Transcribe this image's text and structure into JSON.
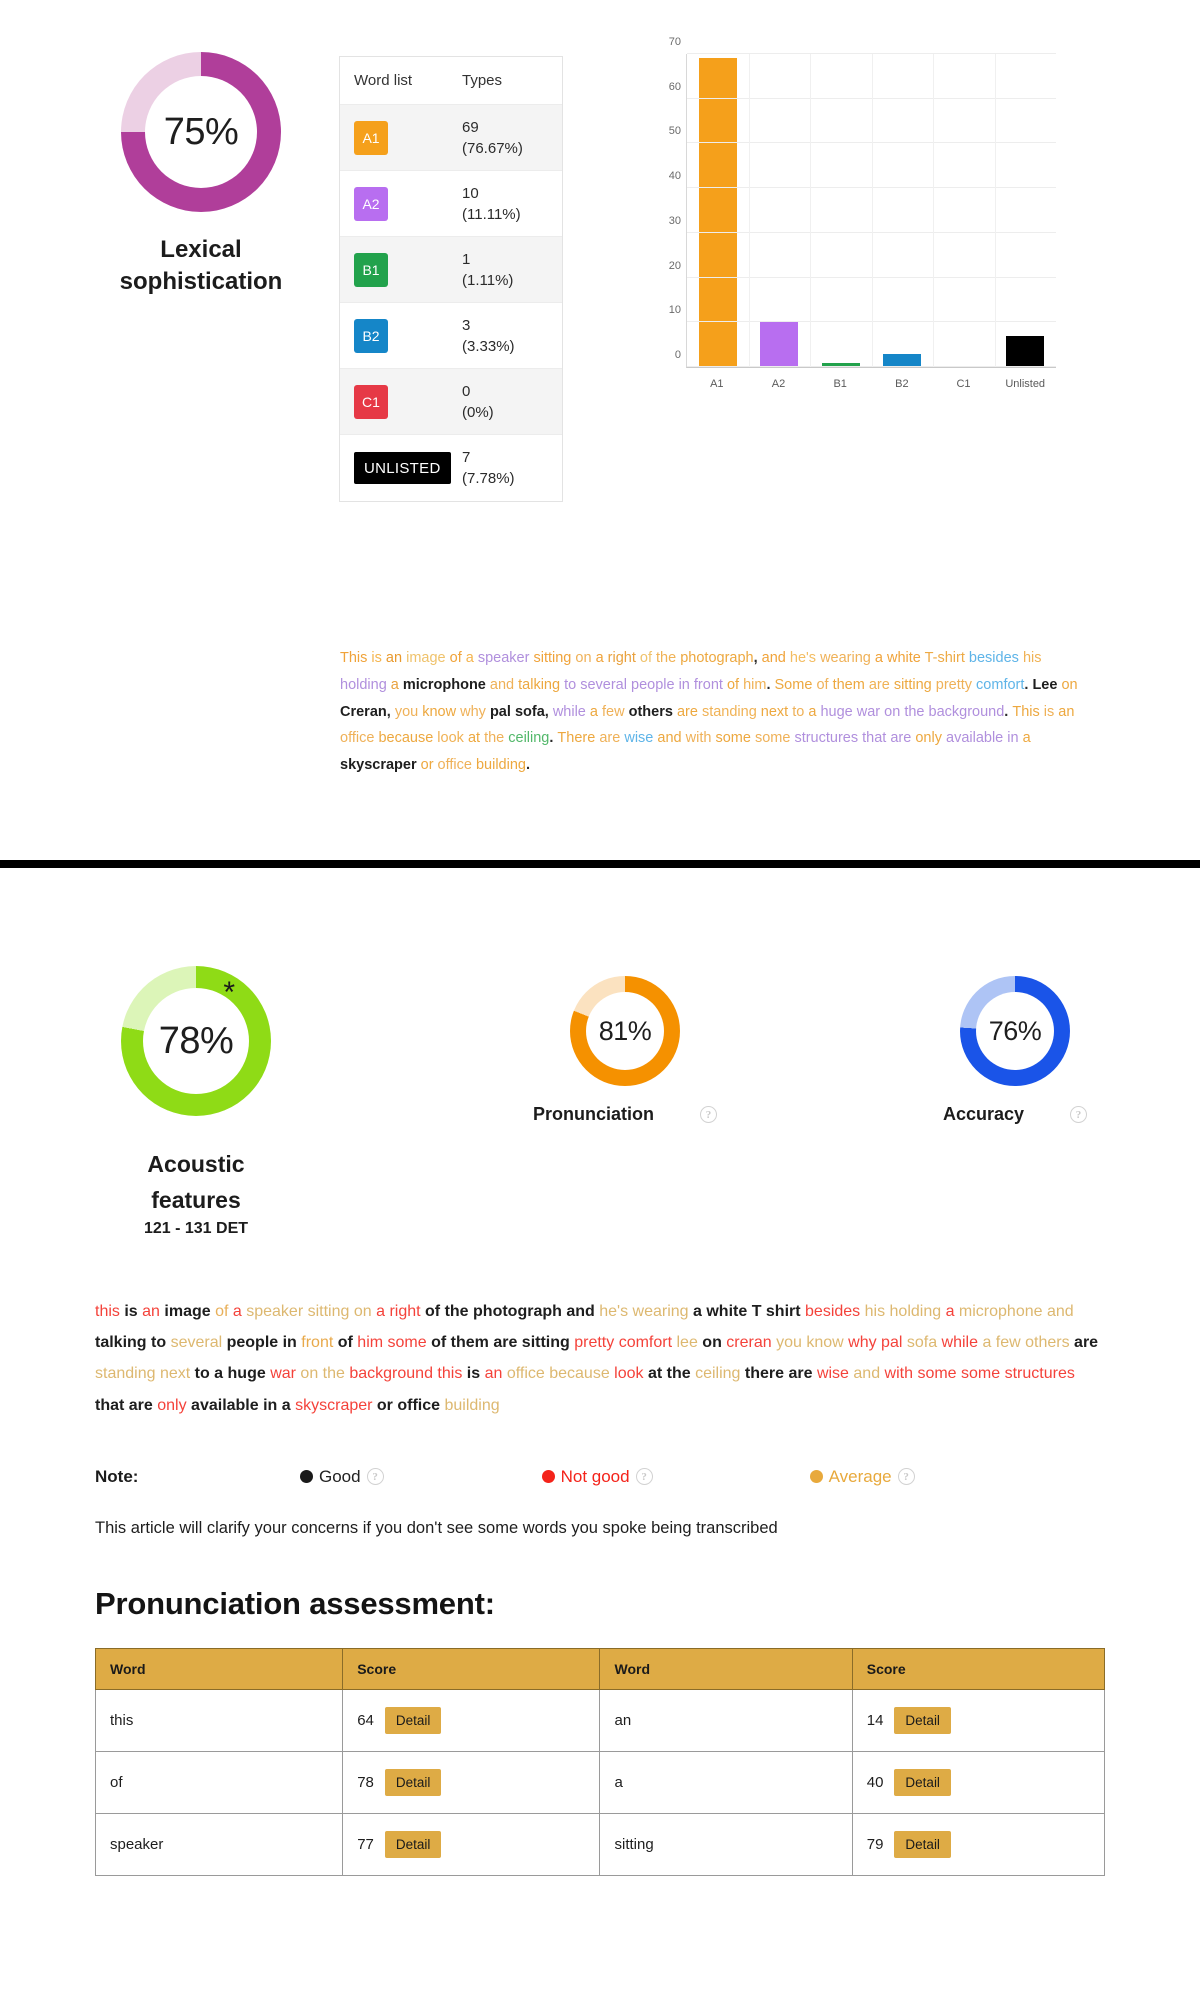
{
  "lexical": {
    "percent_label": "75%",
    "percent_value": 75,
    "caption_line1": "Lexical",
    "caption_line2": "sophistication",
    "track_color": "#ecd0e4",
    "fill_color": "#b03e9a"
  },
  "word_list_table": {
    "headers": [
      "Word list",
      "Types"
    ],
    "rows": [
      {
        "level": "A1",
        "color": "#f5a01b",
        "types": "69",
        "percent": "(76.67%)"
      },
      {
        "level": "A2",
        "color": "#b86ef0",
        "types": "10",
        "percent": "(11.11%)"
      },
      {
        "level": "B1",
        "color": "#22a24c",
        "types": "1",
        "percent": "(1.11%)"
      },
      {
        "level": "B2",
        "color": "#1586c8",
        "types": "3",
        "percent": "(3.33%)"
      },
      {
        "level": "C1",
        "color": "#e63murky",
        "types": "0",
        "percent": "(0%)"
      },
      {
        "level": "UNLISTED",
        "color": "#000000",
        "types": "7",
        "percent": "(7.78%)"
      }
    ]
  },
  "chart_data": {
    "type": "bar",
    "title": "",
    "xlabel": "",
    "ylabel": "",
    "categories": [
      "A1",
      "A2",
      "B1",
      "B2",
      "C1",
      "Unlisted"
    ],
    "values": [
      69,
      10,
      1,
      3,
      0,
      7
    ],
    "colors": [
      "#f5a01b",
      "#b86ef0",
      "#22a24c",
      "#1586c8",
      "#e63946",
      "#000000"
    ],
    "ylim": [
      0,
      70
    ],
    "yticks": [
      0,
      10,
      20,
      30,
      40,
      50,
      60,
      70
    ],
    "ytick_labels": [
      "0",
      "10",
      "20",
      "30",
      "40",
      "50",
      "60",
      "70"
    ],
    "grid": true,
    "legend": "none"
  },
  "paragraph_one": {
    "tokens": [
      {
        "t": "This ",
        "c": "#f0a33a"
      },
      {
        "t": "is ",
        "c": "#f5b54f"
      },
      {
        "t": "an ",
        "c": "#e99a2e"
      },
      {
        "t": "image ",
        "c": "#efc26b"
      },
      {
        "t": "of ",
        "c": "#f0a33a"
      },
      {
        "t": "a ",
        "c": "#f5b54f"
      },
      {
        "t": "speaker ",
        "c": "#b08fdd"
      },
      {
        "t": "sitting ",
        "c": "#f0a33a"
      },
      {
        "t": "on ",
        "c": "#efb158"
      },
      {
        "t": "a ",
        "c": "#f0a33a"
      },
      {
        "t": "right ",
        "c": "#e9a13d"
      },
      {
        "t": "of ",
        "c": "#efc26b"
      },
      {
        "t": "the ",
        "c": "#f0b255"
      },
      {
        "t": "photograph",
        "c": "#eda83f"
      },
      {
        "t": ", ",
        "c": "#2b2b2b"
      },
      {
        "t": "and ",
        "c": "#f0a33a"
      },
      {
        "t": "he's ",
        "c": "#f3bd62"
      },
      {
        "t": "wearing ",
        "c": "#efb158"
      },
      {
        "t": "a ",
        "c": "#f0a33a"
      },
      {
        "t": "white ",
        "c": "#f0a33a"
      },
      {
        "t": "T-shirt ",
        "c": "#edaa45"
      },
      {
        "t": "besides ",
        "c": "#5eb4e8"
      },
      {
        "t": "his ",
        "c": "#f0b255"
      },
      {
        "t": "holding ",
        "c": "#b08fdd"
      },
      {
        "t": "a ",
        "c": "#e9a13d"
      },
      {
        "t": "microphone ",
        "c": "#1e1e1e"
      },
      {
        "t": "and ",
        "c": "#efb158"
      },
      {
        "t": "talking ",
        "c": "#eda83f"
      },
      {
        "t": "to ",
        "c": "#b08fdd"
      },
      {
        "t": "several ",
        "c": "#b08fdd"
      },
      {
        "t": "people ",
        "c": "#b08fdd"
      },
      {
        "t": "in ",
        "c": "#b08fdd"
      },
      {
        "t": "front ",
        "c": "#b08fdd"
      },
      {
        "t": "of ",
        "c": "#eda83f"
      },
      {
        "t": "him",
        "c": "#f0b255"
      },
      {
        "t": ". ",
        "c": "#2b2b2b"
      },
      {
        "t": "Some ",
        "c": "#eda83f"
      },
      {
        "t": "of ",
        "c": "#efb158"
      },
      {
        "t": "them ",
        "c": "#eda83f"
      },
      {
        "t": "are ",
        "c": "#f0b255"
      },
      {
        "t": "sitting ",
        "c": "#eda83f"
      },
      {
        "t": "pretty ",
        "c": "#efb158"
      },
      {
        "t": "comfort",
        "c": "#5eb4e8"
      },
      {
        "t": ". ",
        "c": "#2b2b2b"
      },
      {
        "t": "Lee ",
        "c": "#1e1e1e"
      },
      {
        "t": "on ",
        "c": "#eda83f"
      },
      {
        "t": "Creran",
        "c": "#1e1e1e"
      },
      {
        "t": ", ",
        "c": "#2b2b2b"
      },
      {
        "t": "you ",
        "c": "#efb158"
      },
      {
        "t": "know ",
        "c": "#eda83f"
      },
      {
        "t": "why ",
        "c": "#efb158"
      },
      {
        "t": "pal ",
        "c": "#1e1e1e"
      },
      {
        "t": "sofa",
        "c": "#1e1e1e"
      },
      {
        "t": ", ",
        "c": "#2b2b2b"
      },
      {
        "t": "while ",
        "c": "#b08fdd"
      },
      {
        "t": "a ",
        "c": "#eda83f"
      },
      {
        "t": "few ",
        "c": "#efb158"
      },
      {
        "t": "others ",
        "c": "#1e1e1e"
      },
      {
        "t": "are ",
        "c": "#eda83f"
      },
      {
        "t": "standing ",
        "c": "#f0b255"
      },
      {
        "t": "next ",
        "c": "#eda83f"
      },
      {
        "t": "to ",
        "c": "#efb158"
      },
      {
        "t": "a ",
        "c": "#eda83f"
      },
      {
        "t": "huge ",
        "c": "#b08fdd"
      },
      {
        "t": "war ",
        "c": "#b08fdd"
      },
      {
        "t": "on ",
        "c": "#b08fdd"
      },
      {
        "t": "the ",
        "c": "#b08fdd"
      },
      {
        "t": "background",
        "c": "#b08fdd"
      },
      {
        "t": ". ",
        "c": "#2b2b2b"
      },
      {
        "t": "This ",
        "c": "#eda83f"
      },
      {
        "t": "is ",
        "c": "#efb158"
      },
      {
        "t": "an ",
        "c": "#eda83f"
      },
      {
        "t": "office ",
        "c": "#efb158"
      },
      {
        "t": "because ",
        "c": "#eda83f"
      },
      {
        "t": "look ",
        "c": "#f0b255"
      },
      {
        "t": "at ",
        "c": "#eda83f"
      },
      {
        "t": "the ",
        "c": "#efb158"
      },
      {
        "t": "ceiling",
        "c": "#52b86a"
      },
      {
        "t": ". ",
        "c": "#2b2b2b"
      },
      {
        "t": "There ",
        "c": "#eda83f"
      },
      {
        "t": "are ",
        "c": "#efb158"
      },
      {
        "t": "wise ",
        "c": "#5eb4e8"
      },
      {
        "t": "and ",
        "c": "#eda83f"
      },
      {
        "t": "with ",
        "c": "#efb158"
      },
      {
        "t": "some ",
        "c": "#eda83f"
      },
      {
        "t": "some ",
        "c": "#efb158"
      },
      {
        "t": "structures ",
        "c": "#b08fdd"
      },
      {
        "t": "that ",
        "c": "#b08fdd"
      },
      {
        "t": "are ",
        "c": "#b08fdd"
      },
      {
        "t": "only ",
        "c": "#eda83f"
      },
      {
        "t": "available ",
        "c": "#b08fdd"
      },
      {
        "t": "in ",
        "c": "#b08fdd"
      },
      {
        "t": "a ",
        "c": "#eda83f"
      },
      {
        "t": "skyscraper ",
        "c": "#1e1e1e"
      },
      {
        "t": "or ",
        "c": "#eda83f"
      },
      {
        "t": "office ",
        "c": "#efb158"
      },
      {
        "t": "building",
        "c": "#eda83f"
      },
      {
        "t": ".",
        "c": "#2b2b2b"
      }
    ]
  },
  "acoustic": {
    "percent_label": "78%",
    "percent_value": 78,
    "star": "*",
    "caption_line1": "Acoustic",
    "caption_line2": "features",
    "sub_caption": "121 - 131 DET",
    "track_color": "#dcf5b8",
    "fill_color": "#8fdb16"
  },
  "pronunciation": {
    "percent_label": "81%",
    "percent_value": 81,
    "caption": "Pronunciation",
    "help_icon": "question-mark-icon",
    "track_color": "#fbe2c0",
    "fill_color": "#f59100"
  },
  "accuracy": {
    "percent_label": "76%",
    "percent_value": 76,
    "caption": "Accuracy",
    "help_icon": "question-mark-icon",
    "track_color": "#aec4f5",
    "fill_color": "#1a54e8"
  },
  "paragraph_two": {
    "tokens": [
      {
        "t": "this ",
        "c": "#f4423a"
      },
      {
        "t": "is ",
        "c": "#1e1e1e"
      },
      {
        "t": "an ",
        "c": "#f4423a"
      },
      {
        "t": "image ",
        "c": "#1e1e1e"
      },
      {
        "t": "of ",
        "c": "#e8b05a"
      },
      {
        "t": "a ",
        "c": "#f4423a"
      },
      {
        "t": "speaker ",
        "c": "#ddb870"
      },
      {
        "t": "sitting ",
        "c": "#ddb870"
      },
      {
        "t": "on ",
        "c": "#ddb870"
      },
      {
        "t": "a ",
        "c": "#f4423a"
      },
      {
        "t": "right ",
        "c": "#f4423a"
      },
      {
        "t": "of ",
        "c": "#1e1e1e"
      },
      {
        "t": "the ",
        "c": "#1e1e1e"
      },
      {
        "t": "photograph ",
        "c": "#1e1e1e"
      },
      {
        "t": "and ",
        "c": "#1e1e1e"
      },
      {
        "t": "he's ",
        "c": "#ddb870"
      },
      {
        "t": "wearing ",
        "c": "#ddb870"
      },
      {
        "t": "a ",
        "c": "#1e1e1e"
      },
      {
        "t": "white ",
        "c": "#1e1e1e"
      },
      {
        "t": "T ",
        "c": "#1e1e1e"
      },
      {
        "t": "shirt ",
        "c": "#1e1e1e"
      },
      {
        "t": "besides ",
        "c": "#f4423a"
      },
      {
        "t": "his ",
        "c": "#ddb870"
      },
      {
        "t": "holding ",
        "c": "#ddb870"
      },
      {
        "t": "a ",
        "c": "#f4423a"
      },
      {
        "t": "microphone ",
        "c": "#ddb870"
      },
      {
        "t": "and ",
        "c": "#ddb870"
      },
      {
        "t": "talking ",
        "c": "#1e1e1e"
      },
      {
        "t": "to ",
        "c": "#1e1e1e"
      },
      {
        "t": "several ",
        "c": "#ddb870"
      },
      {
        "t": "people ",
        "c": "#1e1e1e"
      },
      {
        "t": "in ",
        "c": "#1e1e1e"
      },
      {
        "t": "front ",
        "c": "#e8a94a"
      },
      {
        "t": "of ",
        "c": "#1e1e1e"
      },
      {
        "t": "him ",
        "c": "#f4423a"
      },
      {
        "t": "some ",
        "c": "#f4423a"
      },
      {
        "t": "of ",
        "c": "#1e1e1e"
      },
      {
        "t": "them ",
        "c": "#1e1e1e"
      },
      {
        "t": "are ",
        "c": "#1e1e1e"
      },
      {
        "t": "sitting ",
        "c": "#1e1e1e"
      },
      {
        "t": "pretty ",
        "c": "#f4423a"
      },
      {
        "t": "comfort ",
        "c": "#f4423a"
      },
      {
        "t": "lee ",
        "c": "#ddb870"
      },
      {
        "t": "on ",
        "c": "#1e1e1e"
      },
      {
        "t": "creran ",
        "c": "#f4423a"
      },
      {
        "t": "you ",
        "c": "#ddb870"
      },
      {
        "t": "know ",
        "c": "#ddb870"
      },
      {
        "t": "why ",
        "c": "#f4423a"
      },
      {
        "t": "pal ",
        "c": "#f4423a"
      },
      {
        "t": "sofa ",
        "c": "#ddb870"
      },
      {
        "t": "while ",
        "c": "#f4423a"
      },
      {
        "t": "a ",
        "c": "#ddb870"
      },
      {
        "t": "few ",
        "c": "#ddb870"
      },
      {
        "t": "others ",
        "c": "#ddb870"
      },
      {
        "t": "are ",
        "c": "#1e1e1e"
      },
      {
        "t": "standing ",
        "c": "#ddb870"
      },
      {
        "t": "next ",
        "c": "#ddb870"
      },
      {
        "t": "to ",
        "c": "#1e1e1e"
      },
      {
        "t": "a ",
        "c": "#1e1e1e"
      },
      {
        "t": "huge ",
        "c": "#1e1e1e"
      },
      {
        "t": "war ",
        "c": "#f4423a"
      },
      {
        "t": "on ",
        "c": "#ddb870"
      },
      {
        "t": "the ",
        "c": "#ddb870"
      },
      {
        "t": "background ",
        "c": "#f4423a"
      },
      {
        "t": "this ",
        "c": "#f4423a"
      },
      {
        "t": "is ",
        "c": "#1e1e1e"
      },
      {
        "t": "an ",
        "c": "#f4423a"
      },
      {
        "t": "office ",
        "c": "#ddb870"
      },
      {
        "t": "because ",
        "c": "#ddb870"
      },
      {
        "t": "look ",
        "c": "#f4423a"
      },
      {
        "t": "at ",
        "c": "#1e1e1e"
      },
      {
        "t": "the ",
        "c": "#1e1e1e"
      },
      {
        "t": "ceiling ",
        "c": "#ddb870"
      },
      {
        "t": "there ",
        "c": "#1e1e1e"
      },
      {
        "t": "are ",
        "c": "#1e1e1e"
      },
      {
        "t": "wise ",
        "c": "#f4423a"
      },
      {
        "t": "and ",
        "c": "#ddb870"
      },
      {
        "t": "with ",
        "c": "#f4423a"
      },
      {
        "t": "some ",
        "c": "#f4423a"
      },
      {
        "t": "some ",
        "c": "#f4423a"
      },
      {
        "t": "structures ",
        "c": "#f4423a"
      },
      {
        "t": "that ",
        "c": "#1e1e1e"
      },
      {
        "t": "are ",
        "c": "#1e1e1e"
      },
      {
        "t": "only ",
        "c": "#f4423a"
      },
      {
        "t": "available ",
        "c": "#1e1e1e"
      },
      {
        "t": "in ",
        "c": "#1e1e1e"
      },
      {
        "t": "a ",
        "c": "#1e1e1e"
      },
      {
        "t": "skyscraper ",
        "c": "#f4423a"
      },
      {
        "t": "or ",
        "c": "#1e1e1e"
      },
      {
        "t": "office ",
        "c": "#1e1e1e"
      },
      {
        "t": "building",
        "c": "#ddb870"
      }
    ]
  },
  "note": {
    "label": "Note:",
    "items": [
      {
        "label": "Good",
        "color": "#1a1a1a",
        "help_icon": "question-mark-icon"
      },
      {
        "label": "Not good",
        "color": "#f4231a",
        "help_icon": "question-mark-icon"
      },
      {
        "label": "Average",
        "color": "#e8a93c",
        "help_icon": "question-mark-icon"
      }
    ]
  },
  "article_line": "This article will clarify your concerns if you don't see some words you spoke being transcribed",
  "assessment": {
    "title": "Pronunciation assessment:",
    "headers": [
      "Word",
      "Score",
      "Word",
      "Score"
    ],
    "detail_label": "Detail",
    "rows": [
      {
        "word_a": "this",
        "score_a": "64",
        "word_b": "an",
        "score_b": "14"
      },
      {
        "word_a": "of",
        "score_a": "78",
        "word_b": "a",
        "score_b": "40"
      },
      {
        "word_a": "speaker",
        "score_a": "77",
        "word_b": "sitting",
        "score_b": "79"
      }
    ]
  }
}
